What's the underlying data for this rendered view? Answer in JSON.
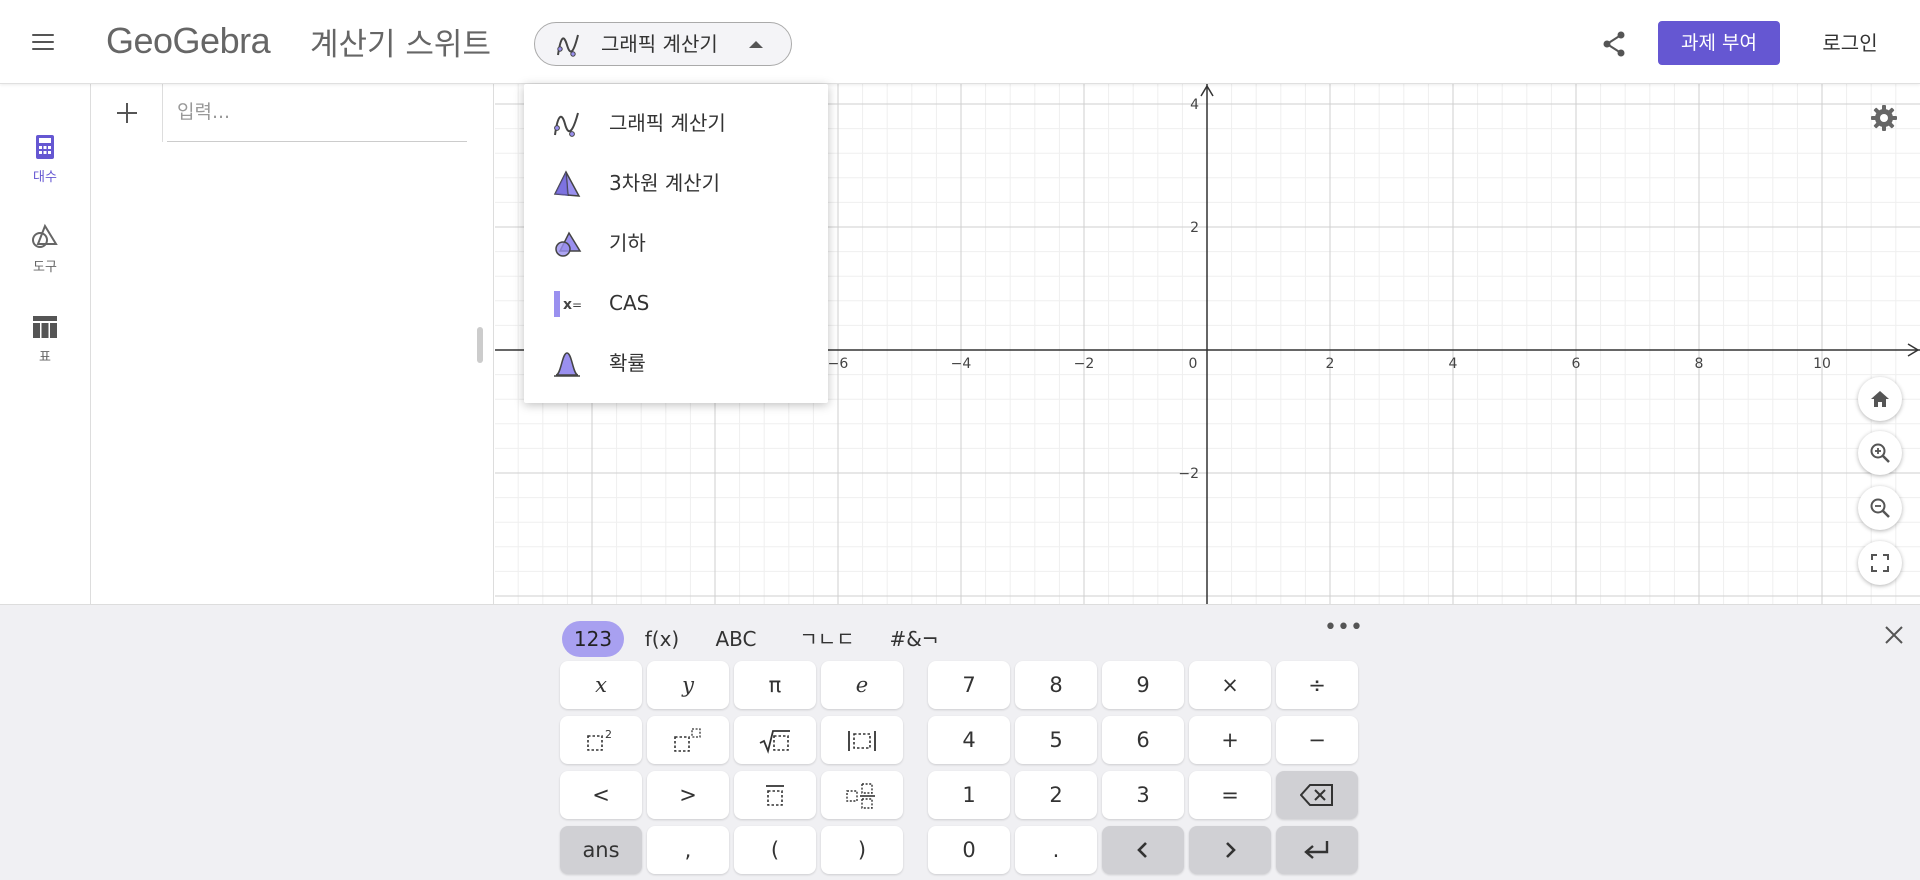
{
  "header": {
    "logo": "GeoGebra",
    "suite_title": "계산기 스위트",
    "app_switch_label": "그래픽 계산기",
    "assign_label": "과제 부여",
    "login_label": "로그인"
  },
  "rail": {
    "items": [
      {
        "label": "대수",
        "icon": "calculator-icon",
        "active": true
      },
      {
        "label": "도구",
        "icon": "tools-icon",
        "active": false
      },
      {
        "label": "표",
        "icon": "table-icon",
        "active": false
      }
    ]
  },
  "algebra": {
    "input_placeholder": "입력..."
  },
  "dropdown": {
    "items": [
      {
        "label": "그래픽 계산기",
        "icon": "graphing-icon"
      },
      {
        "label": "3차원 계산기",
        "icon": "3d-pyramid-icon"
      },
      {
        "label": "기하",
        "icon": "geometry-icon"
      },
      {
        "label": "CAS",
        "icon": "cas-icon"
      },
      {
        "label": "확률",
        "icon": "probability-icon"
      }
    ]
  },
  "graph": {
    "x_ticks": [
      "−6",
      "−4",
      "−2",
      "0",
      "2",
      "4",
      "6",
      "8",
      "10"
    ],
    "y_ticks": [
      "4",
      "2",
      "−2"
    ]
  },
  "keyboard": {
    "tabs": [
      "123",
      "f(x)",
      "ABC",
      "ㄱㄴㄷ",
      "#&¬"
    ],
    "active_tab": "123",
    "more": "•••",
    "keys": {
      "x": "x",
      "y": "y",
      "pi": "π",
      "e": "e",
      "lt": "<",
      "gt": ">",
      "seven": "7",
      "eight": "8",
      "nine": "9",
      "times": "×",
      "divide": "÷",
      "four": "4",
      "five": "5",
      "six": "6",
      "plus": "+",
      "minus": "−",
      "one": "1",
      "two": "2",
      "three": "3",
      "equals": "=",
      "ans": "ans",
      "comma": ",",
      "lparen": "(",
      "rparen": ")",
      "zero": "0",
      "dot": "."
    }
  },
  "colors": {
    "accent": "#6557d2",
    "tab_active": "#a8a0f0",
    "grid_minor": "#efefef",
    "grid_major": "#cfcfcf",
    "axis": "#333333"
  }
}
